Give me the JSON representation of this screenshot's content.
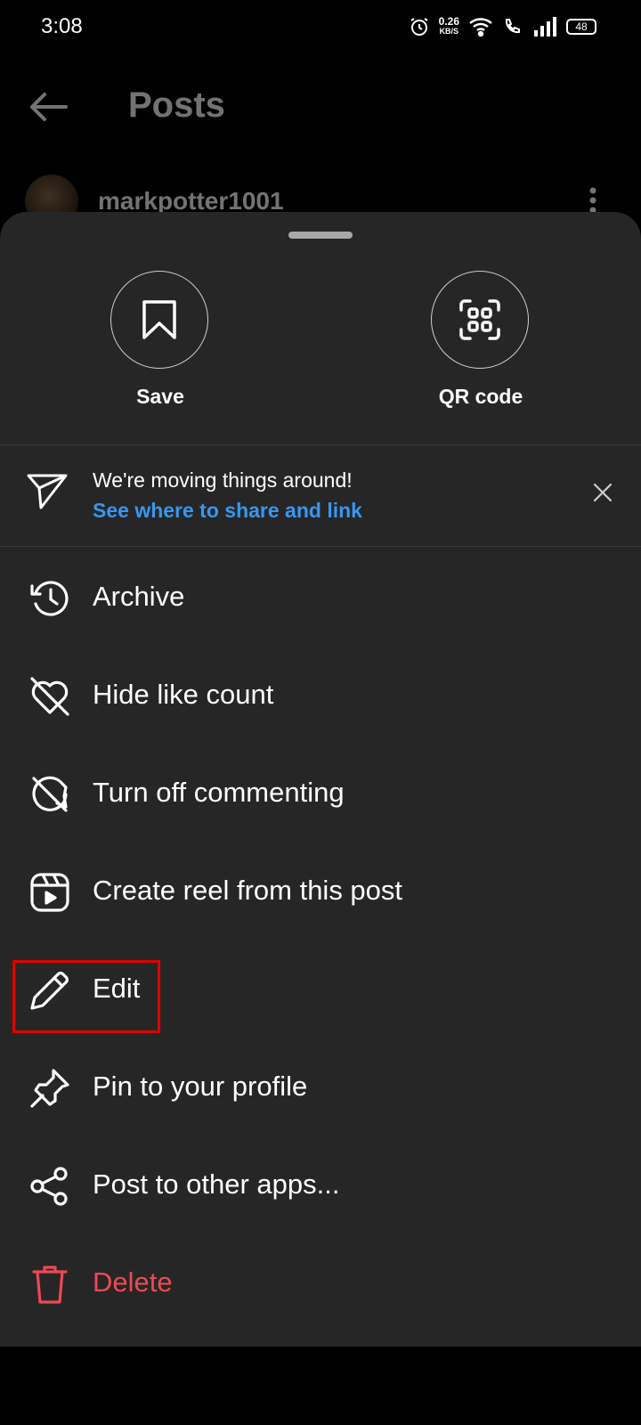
{
  "status": {
    "time": "3:08",
    "speed_value": "0.26",
    "speed_unit": "KB/S",
    "battery": "48"
  },
  "header": {
    "title": "Posts"
  },
  "post": {
    "username": "markpotter1001"
  },
  "sheet": {
    "quick_actions": [
      {
        "label": "Save",
        "icon": "bookmark-icon"
      },
      {
        "label": "QR code",
        "icon": "qr-code-icon"
      }
    ],
    "notice": {
      "text": "We're moving things around!",
      "link": "See where to share and link",
      "link_color": "#3897f0"
    },
    "menu": [
      {
        "label": "Archive",
        "icon": "archive-icon"
      },
      {
        "label": "Hide like count",
        "icon": "hide-like-icon"
      },
      {
        "label": "Turn off commenting",
        "icon": "comment-off-icon"
      },
      {
        "label": "Create reel from this post",
        "icon": "reel-icon"
      },
      {
        "label": "Edit",
        "icon": "pencil-icon"
      },
      {
        "label": "Pin to your profile",
        "icon": "pin-icon"
      },
      {
        "label": "Post to other apps...",
        "icon": "share-icon"
      },
      {
        "label": "Delete",
        "icon": "trash-icon",
        "color": "#ed4956"
      }
    ],
    "background": "#262626"
  }
}
